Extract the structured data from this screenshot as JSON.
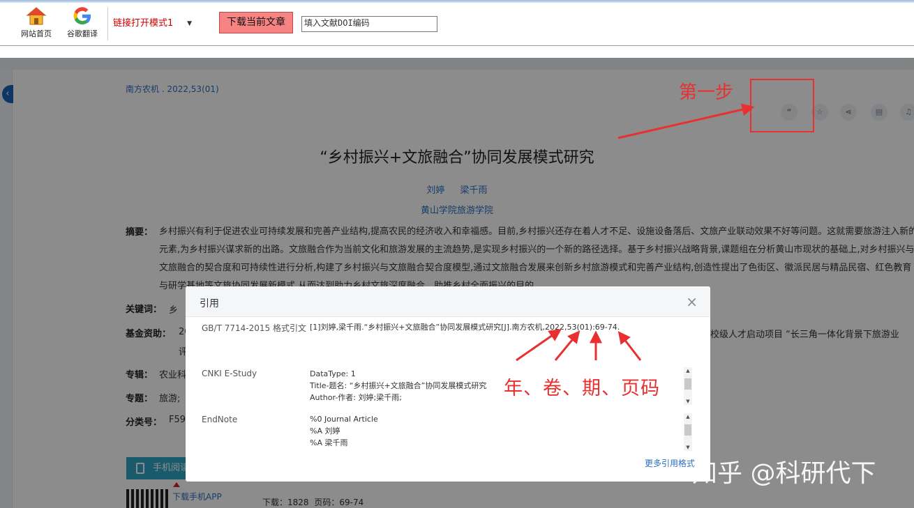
{
  "toolbar": {
    "home_label": "网站首页",
    "translate_label": "谷歌翻译",
    "mode_select": "链接打开模式1",
    "download_button": "下载当前文章",
    "doi_placeholder": "填入文献DOI编码"
  },
  "article": {
    "source": "南方农机 . 2022,53(01)",
    "title": "“乡村振兴+文旅融合”协同发展模式研究",
    "authors": "刘婷 梁千雨",
    "affiliation": "黄山学院旅游学院",
    "abstract_label": "摘要：",
    "abstract_text": "乡村振兴有利于促进农业可持续发展和完善产业结构,提高农民的经济收入和幸福感。目前,乡村振兴还存在着人才不足、设施设备落后、文旅产业联动效果不好等问题。这就需要旅游注入新的元素,为乡村振兴谋求新的出路。文旅融合作为当前文化和旅游发展的主流趋势,是实现乡村振兴的一个新的路径选择。基于乡村振兴战略背景,课题组在分析黄山市现状的基础上,对乡村振兴与文旅融合的契合度和可持续性进行分析,构建了乡村振兴与文旅融合契合度模型,通过文旅融合发展来创新乡村旅游模式和完善产业结构,创造性提出了色街区、徽派民居与精品民宿、红色教育与研学基地等文旅协同发展新模式,从而达到助力乡村文旅深度融合、助推乡村全面振兴的目的。",
    "keywords_label": "关键词：",
    "keywords_value": "乡",
    "fund_label": "基金资助：",
    "fund_value": "20",
    "fund_right": "校级人才启动项目 “长三角一体化背景下旅游业",
    "fund_line2": "评",
    "album_label": "专辑：",
    "album_value": "农业科",
    "topic_label": "专题：",
    "topic_value": "旅游; ",
    "class_label": "分类号：",
    "class_value": "F59",
    "mobile_read": "手机阅读",
    "download_app": "下载手机APP",
    "stats": "下载：1828   页码：69-74"
  },
  "icons": [
    "quote-icon",
    "star-icon",
    "share-icon",
    "print-icon",
    "bell-icon"
  ],
  "dialog": {
    "title": "引用",
    "gbt_label": "GB/T 7714-2015 格式引文",
    "gbt_value": "[1]刘婷,梁千雨.“乡村振兴+文旅融合”协同发展模式研究[J].南方农机,2022,53(01):69-74.",
    "cnki_label": "CNKI E-Study",
    "cnki_lines": [
      "DataType: 1",
      "Title-题名: “乡村振兴+文旅融合”协同发展模式研究",
      "Author-作者: 刘婷;梁千雨;"
    ],
    "endnote_label": "EndNote",
    "endnote_lines": [
      "%0 Journal Article",
      "%A 刘婷",
      "%A 梁千雨"
    ],
    "more_formats": "更多引用格式"
  },
  "annotations": {
    "step_one": "第一步",
    "explain": "年、卷、期、页码",
    "watermark": "知乎 @科研代下",
    "color": "#e83030"
  }
}
